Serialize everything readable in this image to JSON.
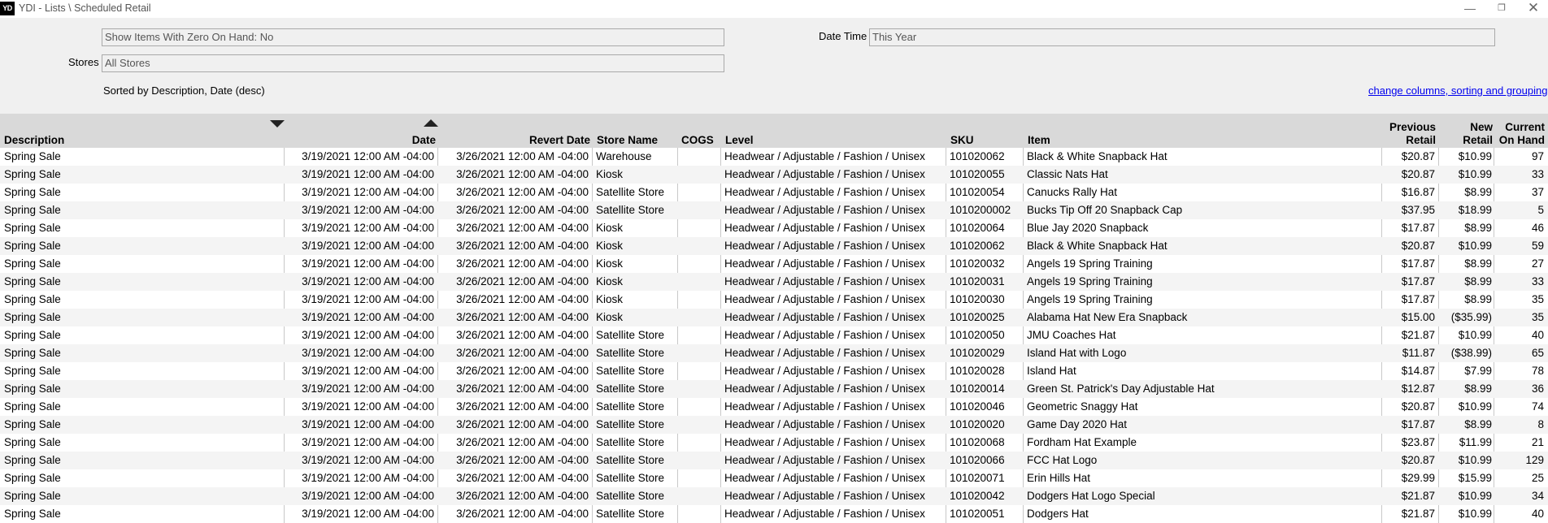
{
  "window": {
    "logo": "YD",
    "title": "YDI - Lists \\ Scheduled Retail",
    "minimize_glyph": "—",
    "maximize_glyph": "❐",
    "close_glyph": "✕"
  },
  "filters": {
    "zero_on_hand_value": "Show Items With Zero On Hand: No",
    "stores_label": "Stores",
    "stores_value": "All Stores",
    "date_time_label": "Date Time",
    "date_time_value": "This Year"
  },
  "sorted_by_text": "Sorted by Description, Date (desc)",
  "change_link_text": "change columns, sorting and grouping",
  "columns": {
    "description": "Description",
    "date": "Date",
    "revert_date": "Revert Date",
    "store_name": "Store Name",
    "cogs": "COGS",
    "level": "Level",
    "sku": "SKU",
    "item": "Item",
    "previous_retail_1": "Previous",
    "previous_retail_2": "Retail",
    "new_retail_1": "New",
    "new_retail_2": "Retail",
    "current_on_hand_1": "Current",
    "current_on_hand_2": "On Hand"
  },
  "sort_icons": {
    "description": "sort-descending-icon",
    "date": "sort-ascending-icon"
  },
  "rows": [
    {
      "description": "Spring Sale",
      "date": "3/19/2021 12:00 AM -04:00",
      "revert_date": "3/26/2021 12:00 AM -04:00",
      "store": "Warehouse",
      "cogs": "",
      "level": "Headwear / Adjustable / Fashion / Unisex",
      "sku": "101020062",
      "item": "Black & White Snapback Hat",
      "prev": "$20.87",
      "new": "$10.99",
      "onhand": "97"
    },
    {
      "description": "Spring Sale",
      "date": "3/19/2021 12:00 AM -04:00",
      "revert_date": "3/26/2021 12:00 AM -04:00",
      "store": "Kiosk",
      "cogs": "",
      "level": "Headwear / Adjustable / Fashion / Unisex",
      "sku": "101020055",
      "item": "Classic Nats Hat",
      "prev": "$20.87",
      "new": "$10.99",
      "onhand": "33"
    },
    {
      "description": "Spring Sale",
      "date": "3/19/2021 12:00 AM -04:00",
      "revert_date": "3/26/2021 12:00 AM -04:00",
      "store": "Satellite Store",
      "cogs": "",
      "level": "Headwear / Adjustable / Fashion / Unisex",
      "sku": "101020054",
      "item": "Canucks Rally Hat",
      "prev": "$16.87",
      "new": "$8.99",
      "onhand": "37"
    },
    {
      "description": "Spring Sale",
      "date": "3/19/2021 12:00 AM -04:00",
      "revert_date": "3/26/2021 12:00 AM -04:00",
      "store": "Satellite Store",
      "cogs": "",
      "level": "Headwear / Adjustable / Fashion / Unisex",
      "sku": "1010200002",
      "item": "Bucks Tip Off 20 Snapback Cap",
      "prev": "$37.95",
      "new": "$18.99",
      "onhand": "5"
    },
    {
      "description": "Spring Sale",
      "date": "3/19/2021 12:00 AM -04:00",
      "revert_date": "3/26/2021 12:00 AM -04:00",
      "store": "Kiosk",
      "cogs": "",
      "level": "Headwear / Adjustable / Fashion / Unisex",
      "sku": "101020064",
      "item": "Blue Jay 2020 Snapback",
      "prev": "$17.87",
      "new": "$8.99",
      "onhand": "46"
    },
    {
      "description": "Spring Sale",
      "date": "3/19/2021 12:00 AM -04:00",
      "revert_date": "3/26/2021 12:00 AM -04:00",
      "store": "Kiosk",
      "cogs": "",
      "level": "Headwear / Adjustable / Fashion / Unisex",
      "sku": "101020062",
      "item": "Black & White Snapback Hat",
      "prev": "$20.87",
      "new": "$10.99",
      "onhand": "59"
    },
    {
      "description": "Spring Sale",
      "date": "3/19/2021 12:00 AM -04:00",
      "revert_date": "3/26/2021 12:00 AM -04:00",
      "store": "Kiosk",
      "cogs": "",
      "level": "Headwear / Adjustable / Fashion / Unisex",
      "sku": "101020032",
      "item": "Angels 19 Spring Training",
      "prev": "$17.87",
      "new": "$8.99",
      "onhand": "27"
    },
    {
      "description": "Spring Sale",
      "date": "3/19/2021 12:00 AM -04:00",
      "revert_date": "3/26/2021 12:00 AM -04:00",
      "store": "Kiosk",
      "cogs": "",
      "level": "Headwear / Adjustable / Fashion / Unisex",
      "sku": "101020031",
      "item": "Angels 19 Spring Training",
      "prev": "$17.87",
      "new": "$8.99",
      "onhand": "33"
    },
    {
      "description": "Spring Sale",
      "date": "3/19/2021 12:00 AM -04:00",
      "revert_date": "3/26/2021 12:00 AM -04:00",
      "store": "Kiosk",
      "cogs": "",
      "level": "Headwear / Adjustable / Fashion / Unisex",
      "sku": "101020030",
      "item": "Angels 19 Spring Training",
      "prev": "$17.87",
      "new": "$8.99",
      "onhand": "35"
    },
    {
      "description": "Spring Sale",
      "date": "3/19/2021 12:00 AM -04:00",
      "revert_date": "3/26/2021 12:00 AM -04:00",
      "store": "Kiosk",
      "cogs": "",
      "level": "Headwear / Adjustable / Fashion / Unisex",
      "sku": "101020025",
      "item": "Alabama Hat New Era Snapback",
      "prev": "$15.00",
      "new": "($35.99)",
      "onhand": "35"
    },
    {
      "description": "Spring Sale",
      "date": "3/19/2021 12:00 AM -04:00",
      "revert_date": "3/26/2021 12:00 AM -04:00",
      "store": "Satellite Store",
      "cogs": "",
      "level": "Headwear / Adjustable / Fashion / Unisex",
      "sku": "101020050",
      "item": "JMU Coaches Hat",
      "prev": "$21.87",
      "new": "$10.99",
      "onhand": "40"
    },
    {
      "description": "Spring Sale",
      "date": "3/19/2021 12:00 AM -04:00",
      "revert_date": "3/26/2021 12:00 AM -04:00",
      "store": "Satellite Store",
      "cogs": "",
      "level": "Headwear / Adjustable / Fashion / Unisex",
      "sku": "101020029",
      "item": "Island Hat with Logo",
      "prev": "$11.87",
      "new": "($38.99)",
      "onhand": "65"
    },
    {
      "description": "Spring Sale",
      "date": "3/19/2021 12:00 AM -04:00",
      "revert_date": "3/26/2021 12:00 AM -04:00",
      "store": "Satellite Store",
      "cogs": "",
      "level": "Headwear / Adjustable / Fashion / Unisex",
      "sku": "101020028",
      "item": "Island Hat",
      "prev": "$14.87",
      "new": "$7.99",
      "onhand": "78"
    },
    {
      "description": "Spring Sale",
      "date": "3/19/2021 12:00 AM -04:00",
      "revert_date": "3/26/2021 12:00 AM -04:00",
      "store": "Satellite Store",
      "cogs": "",
      "level": "Headwear / Adjustable / Fashion / Unisex",
      "sku": "101020014",
      "item": "Green St. Patrick's Day Adjustable Hat",
      "prev": "$12.87",
      "new": "$8.99",
      "onhand": "36"
    },
    {
      "description": "Spring Sale",
      "date": "3/19/2021 12:00 AM -04:00",
      "revert_date": "3/26/2021 12:00 AM -04:00",
      "store": "Satellite Store",
      "cogs": "",
      "level": "Headwear / Adjustable / Fashion / Unisex",
      "sku": "101020046",
      "item": "Geometric Snaggy Hat",
      "prev": "$20.87",
      "new": "$10.99",
      "onhand": "74"
    },
    {
      "description": "Spring Sale",
      "date": "3/19/2021 12:00 AM -04:00",
      "revert_date": "3/26/2021 12:00 AM -04:00",
      "store": "Satellite Store",
      "cogs": "",
      "level": "Headwear / Adjustable / Fashion / Unisex",
      "sku": "101020020",
      "item": "Game Day 2020 Hat",
      "prev": "$17.87",
      "new": "$8.99",
      "onhand": "8"
    },
    {
      "description": "Spring Sale",
      "date": "3/19/2021 12:00 AM -04:00",
      "revert_date": "3/26/2021 12:00 AM -04:00",
      "store": "Satellite Store",
      "cogs": "",
      "level": "Headwear / Adjustable / Fashion / Unisex",
      "sku": "101020068",
      "item": "Fordham Hat Example",
      "prev": "$23.87",
      "new": "$11.99",
      "onhand": "21"
    },
    {
      "description": "Spring Sale",
      "date": "3/19/2021 12:00 AM -04:00",
      "revert_date": "3/26/2021 12:00 AM -04:00",
      "store": "Satellite Store",
      "cogs": "",
      "level": "Headwear / Adjustable / Fashion / Unisex",
      "sku": "101020066",
      "item": "FCC Hat Logo",
      "prev": "$20.87",
      "new": "$10.99",
      "onhand": "129"
    },
    {
      "description": "Spring Sale",
      "date": "3/19/2021 12:00 AM -04:00",
      "revert_date": "3/26/2021 12:00 AM -04:00",
      "store": "Satellite Store",
      "cogs": "",
      "level": "Headwear / Adjustable / Fashion / Unisex",
      "sku": "101020071",
      "item": "Erin Hills Hat",
      "prev": "$29.99",
      "new": "$15.99",
      "onhand": "25"
    },
    {
      "description": "Spring Sale",
      "date": "3/19/2021 12:00 AM -04:00",
      "revert_date": "3/26/2021 12:00 AM -04:00",
      "store": "Satellite Store",
      "cogs": "",
      "level": "Headwear / Adjustable / Fashion / Unisex",
      "sku": "101020042",
      "item": "Dodgers Hat Logo Special",
      "prev": "$21.87",
      "new": "$10.99",
      "onhand": "34"
    },
    {
      "description": "Spring Sale",
      "date": "3/19/2021 12:00 AM -04:00",
      "revert_date": "3/26/2021 12:00 AM -04:00",
      "store": "Satellite Store",
      "cogs": "",
      "level": "Headwear / Adjustable / Fashion / Unisex",
      "sku": "101020051",
      "item": "Dodgers Hat",
      "prev": "$21.87",
      "new": "$10.99",
      "onhand": "40"
    }
  ]
}
